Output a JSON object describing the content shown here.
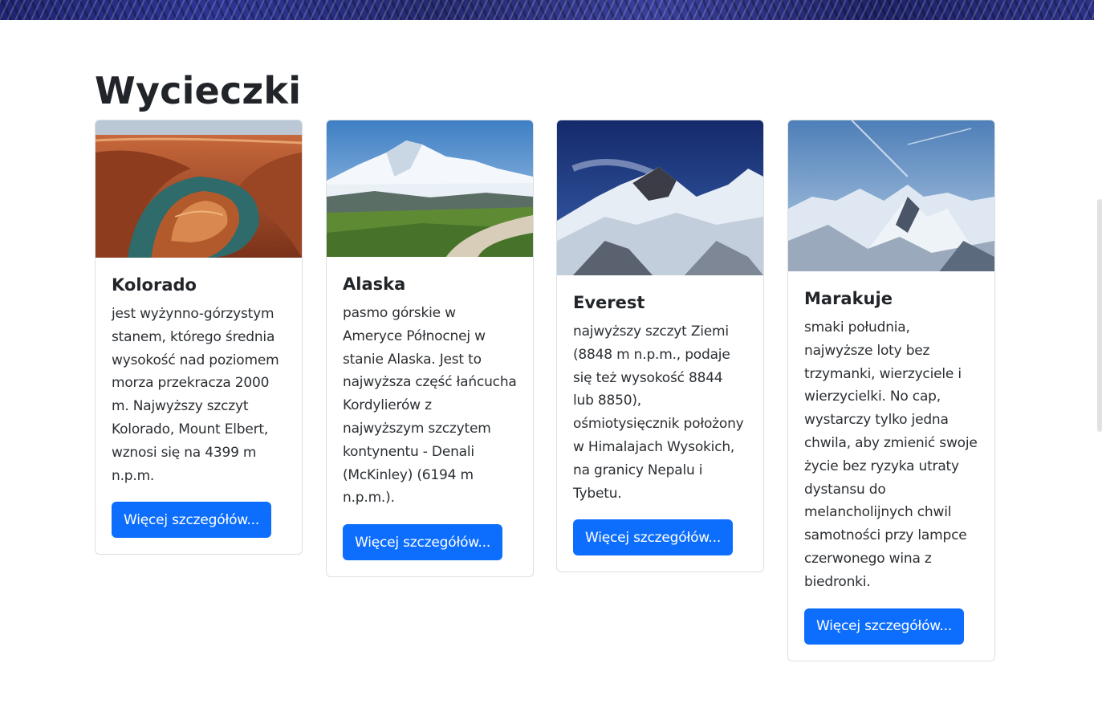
{
  "section": {
    "title": "Wycieczki"
  },
  "cards": [
    {
      "title": "Kolorado",
      "text": "jest wyżynno-górzystym stanem, którego średnia wysokość nad poziomem morza przekracza 2000 m. Najwyższy szczyt Kolorado, Mount Elbert, wznosi się na 4399 m n.p.m.",
      "button": "Więcej szczegółów...",
      "image": "canyon-photo"
    },
    {
      "title": "Alaska",
      "text": "pasmo górskie w Ameryce Północnej w stanie Alaska. Jest to najwyższa część łańcucha Kordylierów z najwyższym szczytem kontynentu - Denali (McKinley) (6194 m n.p.m.).",
      "button": "Więcej szczegółów...",
      "image": "alaska-mountain-photo"
    },
    {
      "title": "Everest",
      "text": "najwyższy szczyt Ziemi (8848 m n.p.m., podaje się też wysokość 8844 lub 8850), ośmiotysięcznik położony w Himalajach Wysokich, na granicy Nepalu i Tybetu.",
      "button": "Więcej szczegółów...",
      "image": "everest-photo"
    },
    {
      "title": "Marakuje",
      "text": "smaki południa, najwyższe loty bez trzymanki, wierzyciele i wierzycielki. No cap, wystarczy tylko jedna chwila, aby zmienić swoje życie bez ryzyka utraty dystansu do melancholijnych chwil samotności przy lampce czerwonego wina z biedronki.",
      "button": "Więcej szczegółów...",
      "image": "snowy-peaks-photo"
    }
  ],
  "colors": {
    "button": "#0d6efd",
    "banner": "#2d3594"
  }
}
